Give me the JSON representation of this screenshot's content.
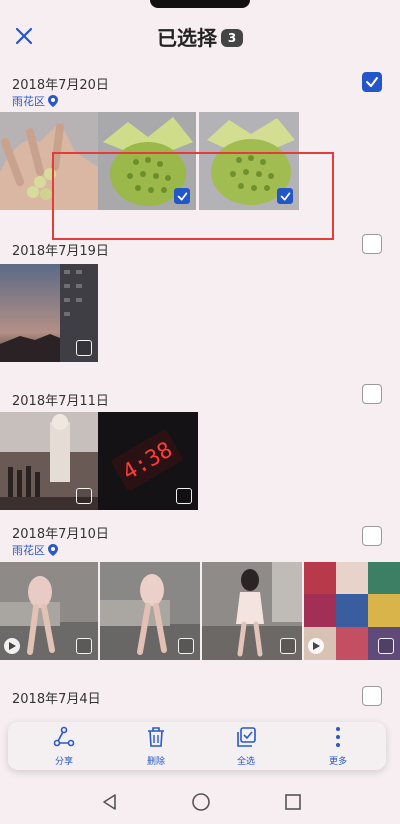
{
  "header": {
    "title": "已选择",
    "selected_count": "3"
  },
  "sections": [
    {
      "date": "2018年7月20日",
      "location": "雨花区",
      "checked": true
    },
    {
      "date": "2018年7月19日",
      "location": "",
      "checked": false
    },
    {
      "date": "2018年7月11日",
      "location": "",
      "checked": false
    },
    {
      "date": "2018年7月10日",
      "location": "雨花区",
      "checked": false
    },
    {
      "date": "2018年7月4日",
      "location": "",
      "checked": false
    }
  ],
  "toolbar": {
    "share_label": "分享",
    "delete_label": "删除",
    "select_all_label": "全选",
    "more_label": "更多"
  },
  "colors": {
    "accent": "#2357c9",
    "highlight": "#e43b3b",
    "background": "#f6eef0"
  },
  "clock_reading": "4:38"
}
